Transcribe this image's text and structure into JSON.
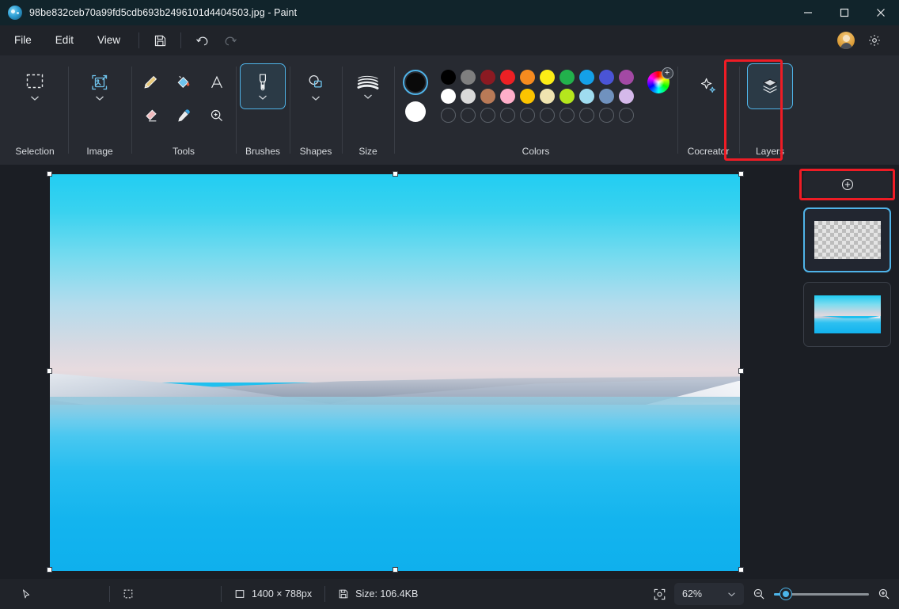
{
  "window": {
    "title": "98be832ceb70a99fd5cdb693b2496101d4404503.jpg - Paint",
    "app_icon": "paint-app-icon",
    "controls": {
      "minimize": "minimize-icon",
      "maximize": "maximize-icon",
      "close": "close-icon"
    }
  },
  "menubar": {
    "items": [
      {
        "label": "File"
      },
      {
        "label": "Edit"
      },
      {
        "label": "View"
      }
    ],
    "buttons": [
      {
        "name": "save-button",
        "icon": "save-icon"
      },
      {
        "name": "undo-button",
        "icon": "undo-icon"
      },
      {
        "name": "redo-button",
        "icon": "redo-icon"
      }
    ],
    "right": [
      {
        "name": "account-avatar",
        "icon": "avatar-icon"
      },
      {
        "name": "settings-button",
        "icon": "gear-icon"
      }
    ]
  },
  "ribbon": {
    "groups": [
      {
        "key": "selection",
        "label": "Selection",
        "icon": "rectangle-select-icon",
        "has_chevron": true,
        "selected": false
      },
      {
        "key": "image",
        "label": "Image",
        "icon": "image-resize-icon",
        "has_chevron": true,
        "selected": false
      },
      {
        "key": "tools",
        "label": "Tools",
        "selected": false
      },
      {
        "key": "brushes",
        "label": "Brushes",
        "icon": "brush-icon",
        "has_chevron": true,
        "selected": true
      },
      {
        "key": "shapes",
        "label": "Shapes",
        "icon": "shapes-icon",
        "has_chevron": true,
        "selected": false
      },
      {
        "key": "size",
        "label": "Size",
        "icon": "line-size-icon",
        "has_chevron": true,
        "selected": false
      },
      {
        "key": "colors",
        "label": "Colors",
        "selected": false
      },
      {
        "key": "cocreator",
        "label": "Cocreator",
        "icon": "sparkle-icon",
        "has_chevron": false,
        "selected": false
      },
      {
        "key": "layers",
        "label": "Layers",
        "icon": "layers-stack-icon",
        "has_chevron": false,
        "selected": true,
        "annotated": true
      }
    ],
    "tools": [
      {
        "name": "pencil-tool",
        "icon": "pencil-icon"
      },
      {
        "name": "fill-tool",
        "icon": "paint-bucket-icon"
      },
      {
        "name": "text-tool",
        "icon": "text-a-icon"
      },
      {
        "name": "eraser-tool",
        "icon": "eraser-icon"
      },
      {
        "name": "eyedropper-tool",
        "icon": "eyedropper-icon"
      },
      {
        "name": "magnifier-tool",
        "icon": "magnifier-icon"
      }
    ],
    "colors": {
      "label": "Colors",
      "primary": "#0a0a0a",
      "secondary": "#ffffff",
      "row1": [
        "#000000",
        "#7f7f7f",
        "#8b1a22",
        "#ed2024",
        "#f68b1f",
        "#fced16",
        "#22b14c",
        "#14a0e8",
        "#4a54d6",
        "#a349a4"
      ],
      "row2": [
        "#ffffff",
        "#d9d9d9",
        "#b97a57",
        "#ffaec9",
        "#fbc400",
        "#efe4b0",
        "#b5e61d",
        "#9fdcf0",
        "#7092be",
        "#d5b9ea"
      ],
      "row3_empty_count": 10,
      "wheel": "color-wheel-icon",
      "wheel_add": "+"
    }
  },
  "canvas": {
    "image_alt": "snow-banks-and-turquoise-water",
    "selection_handles": 8
  },
  "layers_panel": {
    "add_button": {
      "name": "add-layer-button",
      "icon": "plus-circle-icon",
      "annotated": true
    },
    "layers": [
      {
        "name": "layer-thumbnail-transparent",
        "type": "transparent",
        "selected": true
      },
      {
        "name": "layer-thumbnail-image",
        "type": "image",
        "selected": false
      }
    ]
  },
  "statusbar": {
    "cursor_icon": "cursor-arrow-icon",
    "selection_icon": "selection-dashed-icon",
    "dimensions_icon": "canvas-size-icon",
    "dimensions": "1400 × 788px",
    "filesize_icon": "save-disk-icon",
    "filesize": "Size: 106.4KB",
    "fit_icon": "fit-to-window-icon",
    "zoom_value": "62%",
    "zoom_out_icon": "zoom-out-icon",
    "zoom_in_icon": "zoom-in-icon",
    "zoom_chevron": "chevron-down-icon"
  },
  "accent": "#4fb3e8",
  "annotation_color": "#ee1c25"
}
